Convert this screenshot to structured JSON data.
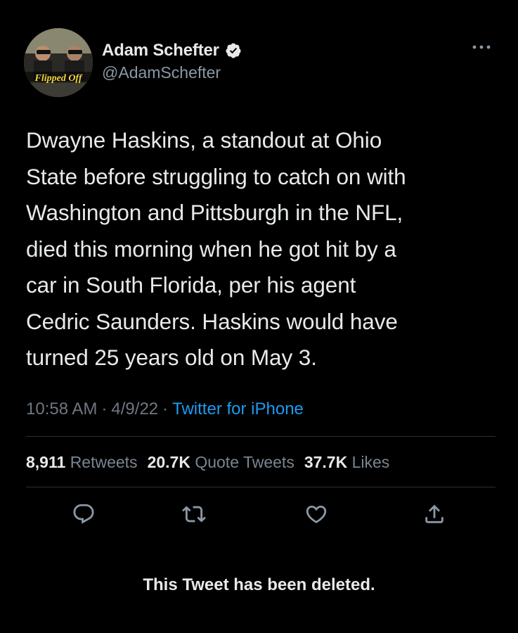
{
  "author": {
    "display_name": "Adam Schefter",
    "handle": "@AdamSchefter",
    "avatar_icon": "avatar-photo",
    "avatar_text": "Flipped Off",
    "verified_icon": "verified-badge-icon"
  },
  "tweet": {
    "text": "Dwayne Haskins, a standout at Ohio\nState before struggling to catch on with\nWashington and Pittsburgh in the NFL,\ndied this morning when he got hit by a\ncar in South Florida, per his agent\nCedric Saunders. Haskins would have\nturned 25 years old on May 3.",
    "time": "10:58 AM",
    "date": "4/9/22",
    "source": "Twitter for iPhone",
    "separator": "·"
  },
  "stats": {
    "retweets_count": "8,911",
    "retweets_label": "Retweets",
    "quotes_count": "20.7K",
    "quotes_label": "Quote Tweets",
    "likes_count": "37.7K",
    "likes_label": "Likes"
  },
  "actions": {
    "reply_icon": "reply-icon",
    "retweet_icon": "retweet-icon",
    "like_icon": "like-icon",
    "share_icon": "share-icon",
    "more_icon": "more-icon"
  },
  "notice": {
    "deleted_text": "This Tweet has been deleted."
  },
  "colors": {
    "background": "#000000",
    "text": "#e7e9ea",
    "secondary": "#8b98a5",
    "link": "#1d9bf0",
    "verified": "#e7e9ea",
    "divider": "#2b2f33"
  }
}
